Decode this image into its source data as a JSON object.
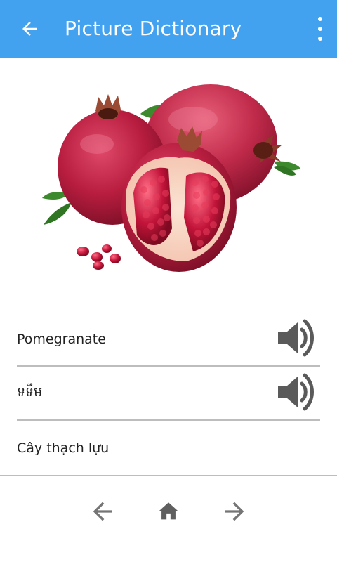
{
  "app_bar": {
    "title": "Picture Dictionary",
    "back_icon": "arrow-back-icon",
    "menu_icon": "more-vert-icon",
    "color": "#42a2ef"
  },
  "picture": {
    "subject": "pomegranate"
  },
  "entries": [
    {
      "label": "Pomegranate",
      "has_audio": true
    },
    {
      "label": "ទទឹម",
      "has_audio": true
    },
    {
      "label": "Cây thạch lựu",
      "has_audio": false
    }
  ],
  "bottom_nav": {
    "prev_icon": "arrow-left-icon",
    "home_icon": "home-icon",
    "next_icon": "arrow-right-icon",
    "icon_color": "#757575"
  }
}
